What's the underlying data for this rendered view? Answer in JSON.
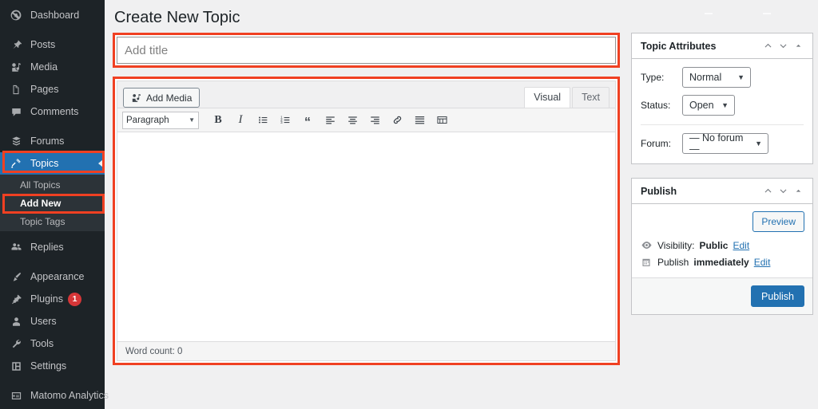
{
  "sidebar": {
    "items": [
      {
        "label": "Dashboard",
        "icon": "dashboard-icon"
      },
      {
        "label": "Posts",
        "icon": "pin-icon"
      },
      {
        "label": "Media",
        "icon": "media-icon"
      },
      {
        "label": "Pages",
        "icon": "pages-icon"
      },
      {
        "label": "Comments",
        "icon": "comment-icon"
      },
      {
        "label": "Forums",
        "icon": "forums-icon"
      },
      {
        "label": "Topics",
        "icon": "topics-icon"
      },
      {
        "label": "Replies",
        "icon": "replies-icon"
      },
      {
        "label": "Appearance",
        "icon": "brush-icon"
      },
      {
        "label": "Plugins",
        "icon": "plug-icon",
        "badge": "1"
      },
      {
        "label": "Users",
        "icon": "user-icon"
      },
      {
        "label": "Tools",
        "icon": "wrench-icon"
      },
      {
        "label": "Settings",
        "icon": "settings-icon"
      },
      {
        "label": "Matomo Analytics",
        "icon": "analytics-icon"
      }
    ],
    "submenu": [
      {
        "label": "All Topics"
      },
      {
        "label": "Add New"
      },
      {
        "label": "Topic Tags"
      }
    ]
  },
  "page": {
    "title": "Create New Topic"
  },
  "title_field": {
    "value": "",
    "placeholder": "Add title"
  },
  "editor": {
    "add_media_label": "Add Media",
    "tabs": [
      {
        "label": "Visual"
      },
      {
        "label": "Text"
      }
    ],
    "format_select": "Paragraph",
    "toolbar_buttons": [
      {
        "name": "bold-icon",
        "label": "B"
      },
      {
        "name": "italic-icon",
        "label": "I"
      },
      {
        "name": "bulleted-list-icon",
        "label": ""
      },
      {
        "name": "numbered-list-icon",
        "label": ""
      },
      {
        "name": "blockquote-icon",
        "label": "“"
      },
      {
        "name": "align-left-icon",
        "label": ""
      },
      {
        "name": "align-center-icon",
        "label": ""
      },
      {
        "name": "align-right-icon",
        "label": ""
      },
      {
        "name": "link-icon",
        "label": ""
      },
      {
        "name": "read-more-icon",
        "label": ""
      },
      {
        "name": "toolbar-toggle-icon",
        "label": ""
      }
    ],
    "content": "",
    "word_count": "Word count: 0"
  },
  "topic_attributes": {
    "title": "Topic Attributes",
    "type_label": "Type:",
    "type_value": "Normal",
    "status_label": "Status:",
    "status_value": "Open",
    "forum_label": "Forum:",
    "forum_value": "— No forum —"
  },
  "publish": {
    "title": "Publish",
    "preview_label": "Preview",
    "visibility_prefix": "Visibility:",
    "visibility_value": "Public",
    "visibility_edit": "Edit",
    "schedule_prefix": "Publish",
    "schedule_value": "immediately",
    "schedule_edit": "Edit",
    "publish_label": "Publish"
  },
  "colors": {
    "highlight": "#f04022",
    "accent": "#2271b1",
    "sidebar_bg": "#1d2327",
    "badge": "#d63638"
  }
}
